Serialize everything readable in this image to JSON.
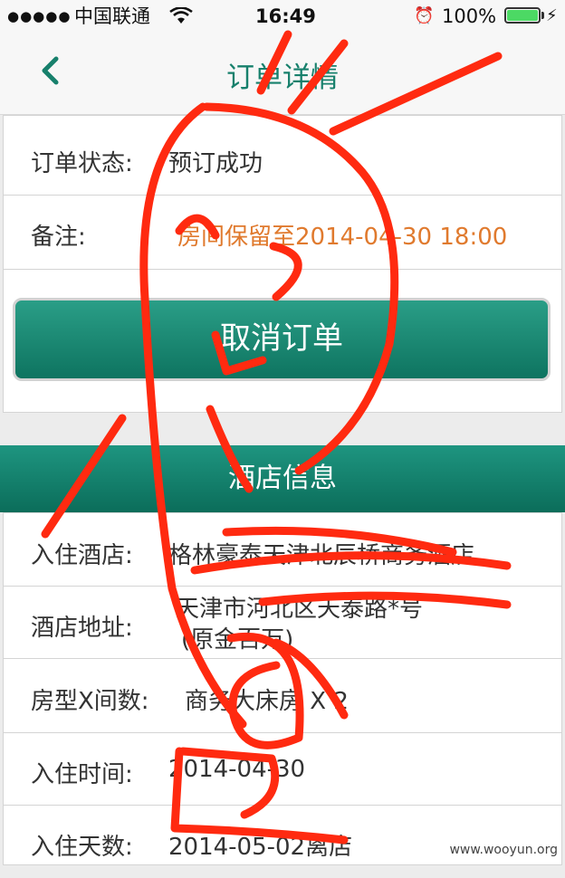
{
  "status_bar": {
    "signal_dots": "●●●●●",
    "carrier": "中国联通",
    "time": "16:49",
    "battery_percent": "100%",
    "icons": [
      "wifi-icon",
      "alarm-icon",
      "battery-icon",
      "charging-icon"
    ]
  },
  "nav": {
    "back_icon": "chevron-left-icon",
    "title": "订单详情"
  },
  "order": {
    "status_label": "订单状态:",
    "status_value": "预订成功",
    "remark_label": "备注:",
    "remark_value": "房间保留至2014-04-30 18:00"
  },
  "cancel_button": "取消订单",
  "hotel_section": {
    "title": "酒店信息",
    "rows": [
      {
        "label": "入住酒店:",
        "value": "格林豪泰天津北辰桥商务酒店"
      },
      {
        "label": "酒店地址:",
        "value_line1": "天津市河北区天泰路*号",
        "value_line2": "(原金百万)"
      },
      {
        "label": "房型X间数:",
        "value": "商务大床房 X 2"
      },
      {
        "label": "入住时间:",
        "value": "2014-04-30"
      },
      {
        "label": "入住天数:",
        "value": "2014-05-02离店"
      }
    ]
  },
  "watermark": "www.wooyun.org",
  "colors": {
    "accent": "#17806c",
    "remark": "#e07a2e",
    "scribble": "#ff2a10"
  }
}
